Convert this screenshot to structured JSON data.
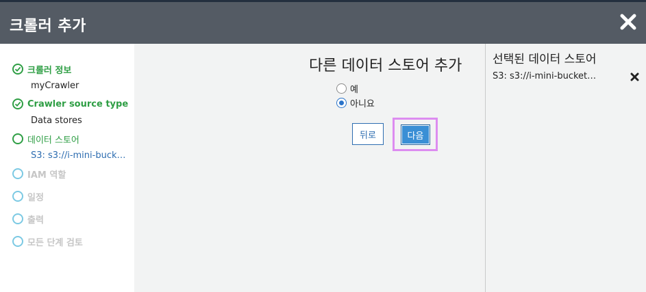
{
  "dialog": {
    "title": "크롤러 추가",
    "close_icon": "close-icon"
  },
  "sidebar": {
    "steps": [
      {
        "label": "크롤러 정보",
        "status": "complete",
        "sub": "myCrawler"
      },
      {
        "label": "Crawler source type",
        "status": "complete",
        "sub": "Data stores"
      },
      {
        "label": "데이터 스토어",
        "status": "current",
        "sub": "S3: s3://i-mini-buck…"
      },
      {
        "label": "IAM 역할",
        "status": "pending"
      },
      {
        "label": "일정",
        "status": "pending"
      },
      {
        "label": "출력",
        "status": "pending"
      },
      {
        "label": "모든 단계 검토",
        "status": "pending"
      }
    ]
  },
  "main": {
    "heading": "다른 데이터 스토어 추가",
    "options": [
      {
        "label": "예",
        "checked": false
      },
      {
        "label": "아니요",
        "checked": true
      }
    ],
    "back_label": "뒤로",
    "next_label": "다음"
  },
  "right_panel": {
    "heading": "선택된 데이터 스토어",
    "selected_store": "S3: s3://i-mini-bucket…",
    "remove_icon": "remove-icon"
  },
  "colors": {
    "header_bg": "#545b64",
    "complete_green": "#2e9e44",
    "pending_blue": "#7bc9e3",
    "link_blue": "#2c6cb0",
    "primary_button": "#3a8fd5",
    "highlight": "#dd8cf0",
    "panel_bg": "#f2f3f3"
  }
}
